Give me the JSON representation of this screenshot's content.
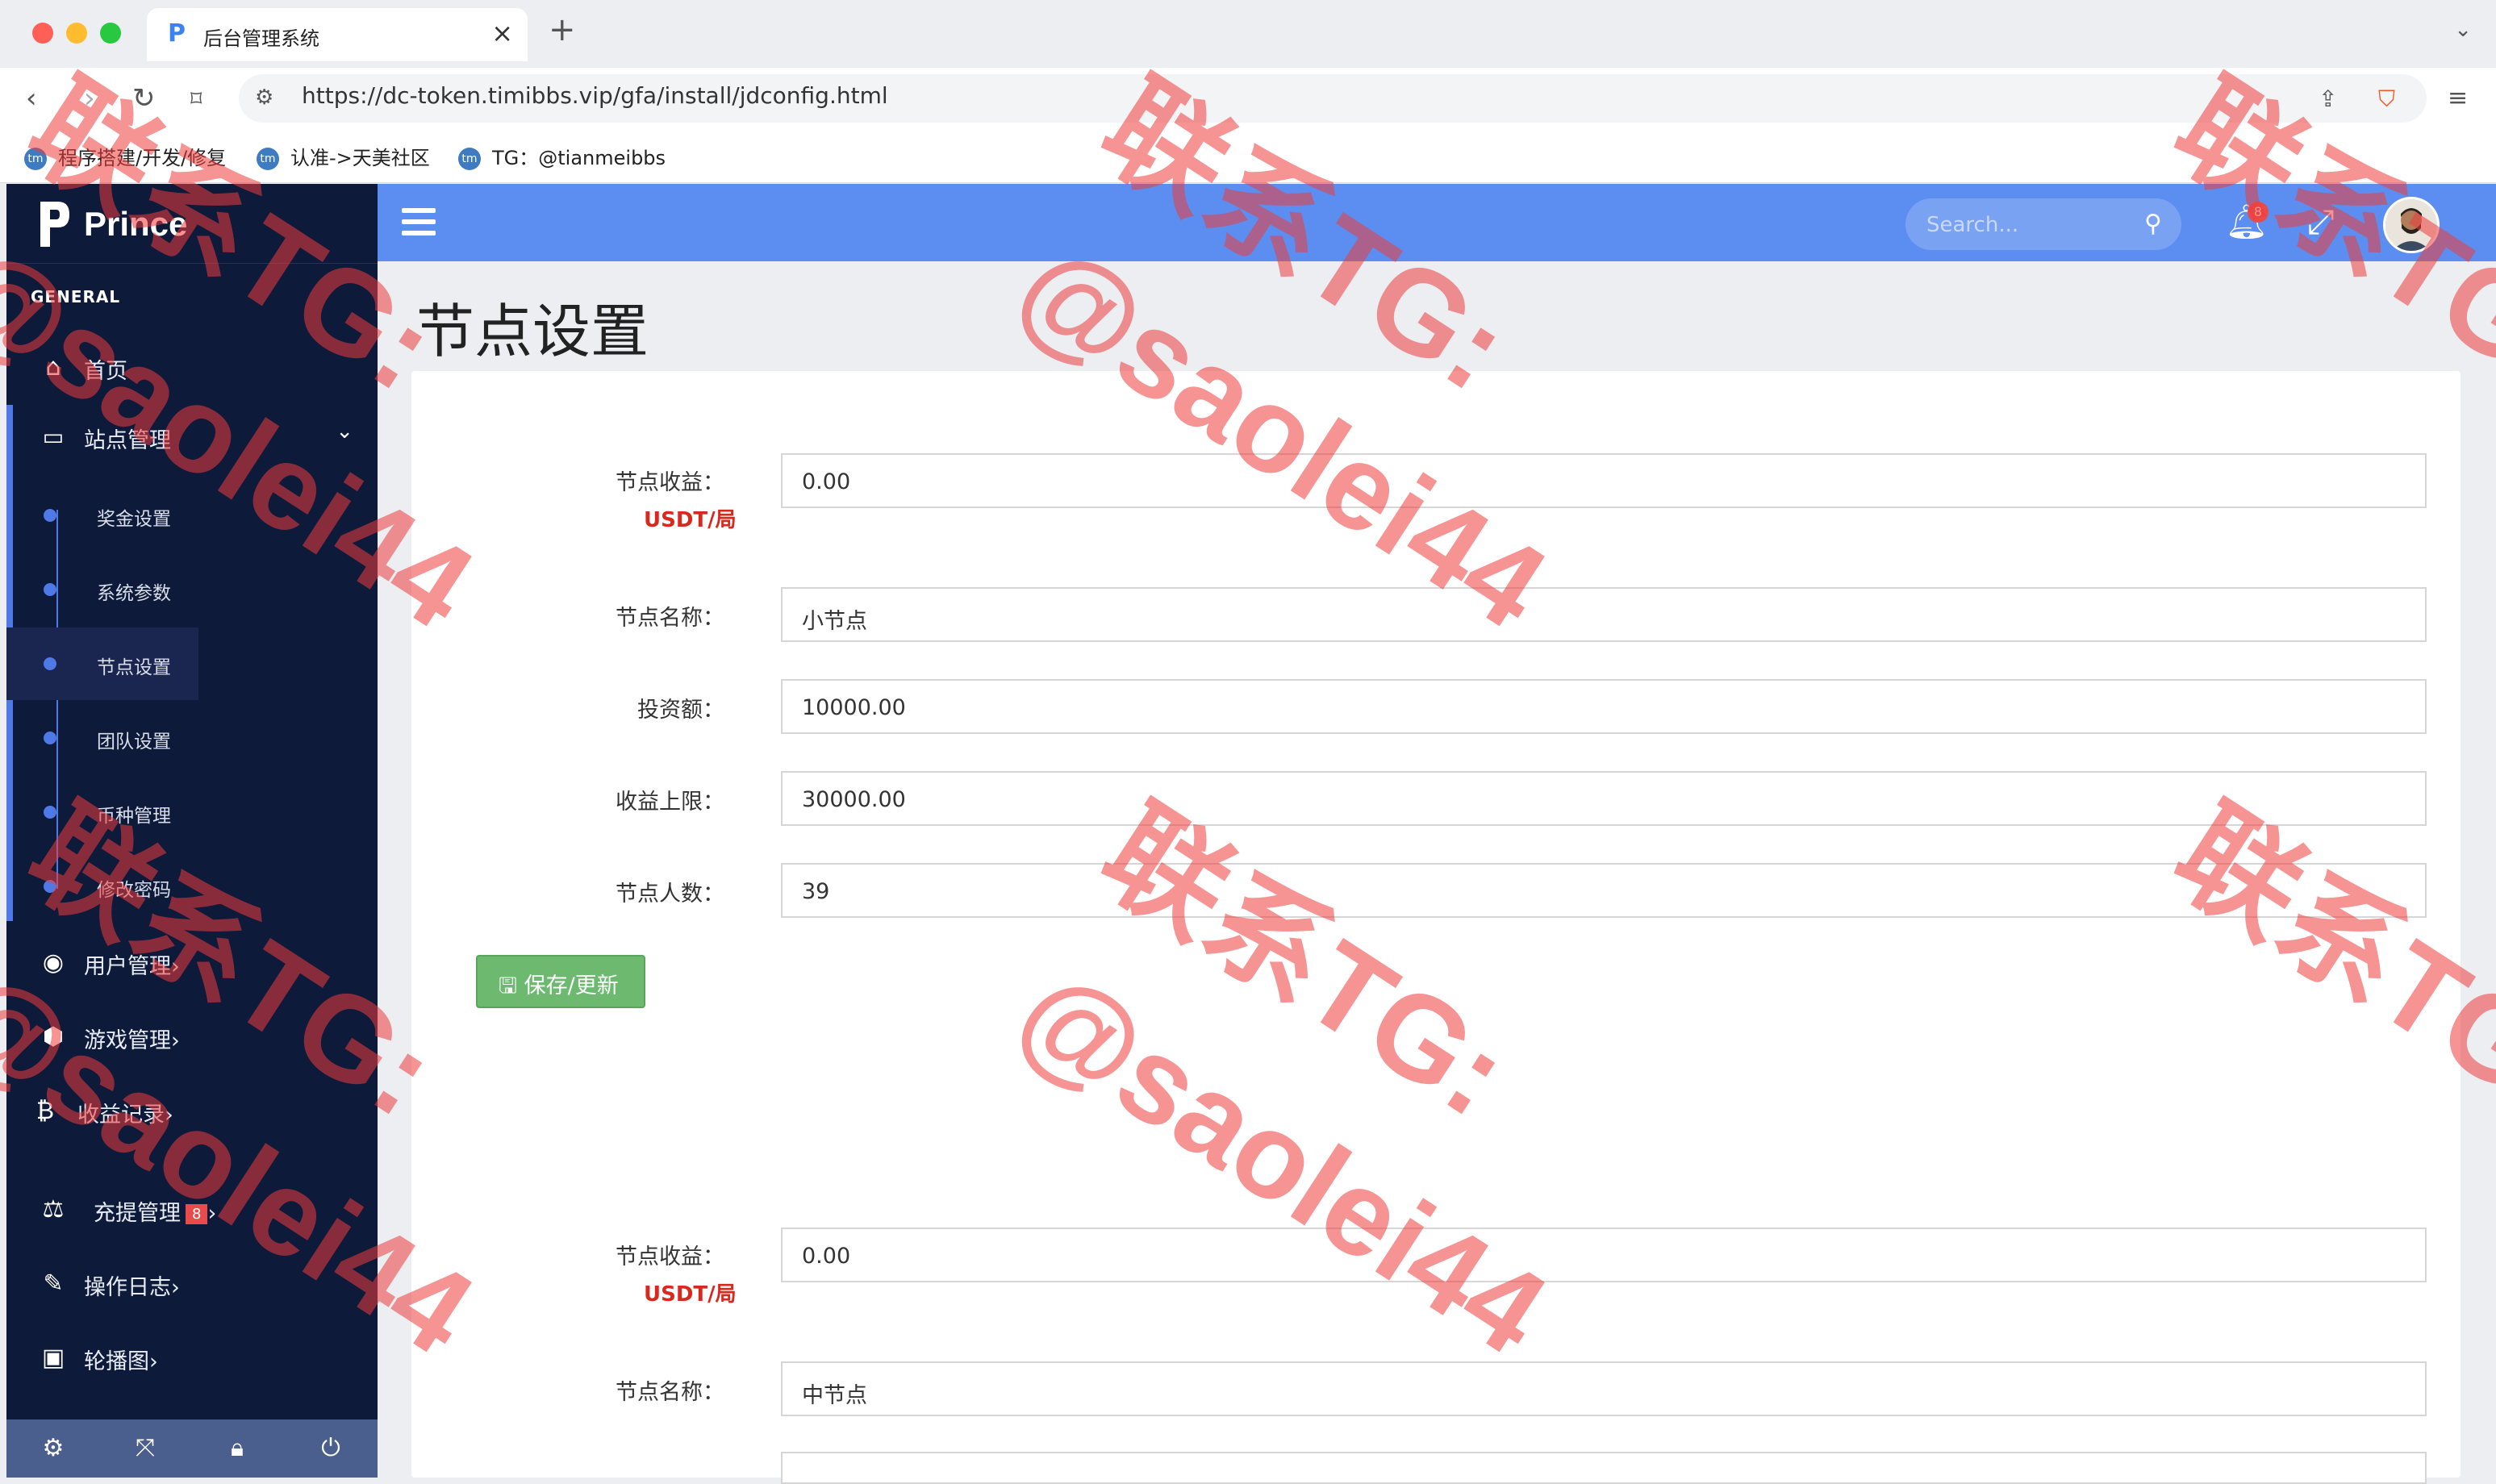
{
  "browser": {
    "tab_title": "后台管理系统",
    "url": "https://dc-token.timibbs.vip/gfa/install/jdconfig.html",
    "bookmarks": [
      "程序搭建/开发/修复",
      "认准->天美社区",
      "TG：@tianmeibbs"
    ]
  },
  "sidebar": {
    "brand": "Prince",
    "section": "GENERAL",
    "home": "首页",
    "site_mgmt": "站点管理",
    "sub_items": [
      "奖金设置",
      "系统参数",
      "节点设置",
      "团队设置",
      "币种管理",
      "修改密码"
    ],
    "user_mgmt": "用户管理",
    "game_mgmt": "游戏管理",
    "income": "收益记录",
    "recharge": "充提管理",
    "recharge_badge": "8",
    "oplog": "操作日志",
    "carousel": "轮播图"
  },
  "header": {
    "search_placeholder": "Search...",
    "notif_count": "8"
  },
  "page": {
    "title": "节点设置",
    "form1": {
      "income_label": "节点收益：",
      "income_unit": "USDT/局",
      "income_value": "0.00",
      "name_label": "节点名称：",
      "name_value": "小节点",
      "invest_label": "投资额：",
      "invest_value": "10000.00",
      "limit_label": "收益上限：",
      "limit_value": "30000.00",
      "count_label": "节点人数：",
      "count_value": "39",
      "save_label": "保存/更新"
    },
    "form2": {
      "income_label": "节点收益：",
      "income_unit": "USDT/局",
      "income_value": "0.00",
      "name_label": "节点名称：",
      "name_value": "中节点"
    }
  },
  "watermark": {
    "line1": "联系TG:",
    "line2": "@saolei44"
  },
  "colors": {
    "sidebar": "#0d1a3a",
    "topbar": "#5b8ef0",
    "accent": "#4e79e6",
    "save": "#6cb96f",
    "unit_red": "#d9281c",
    "watermark": "#ee3c3c"
  }
}
